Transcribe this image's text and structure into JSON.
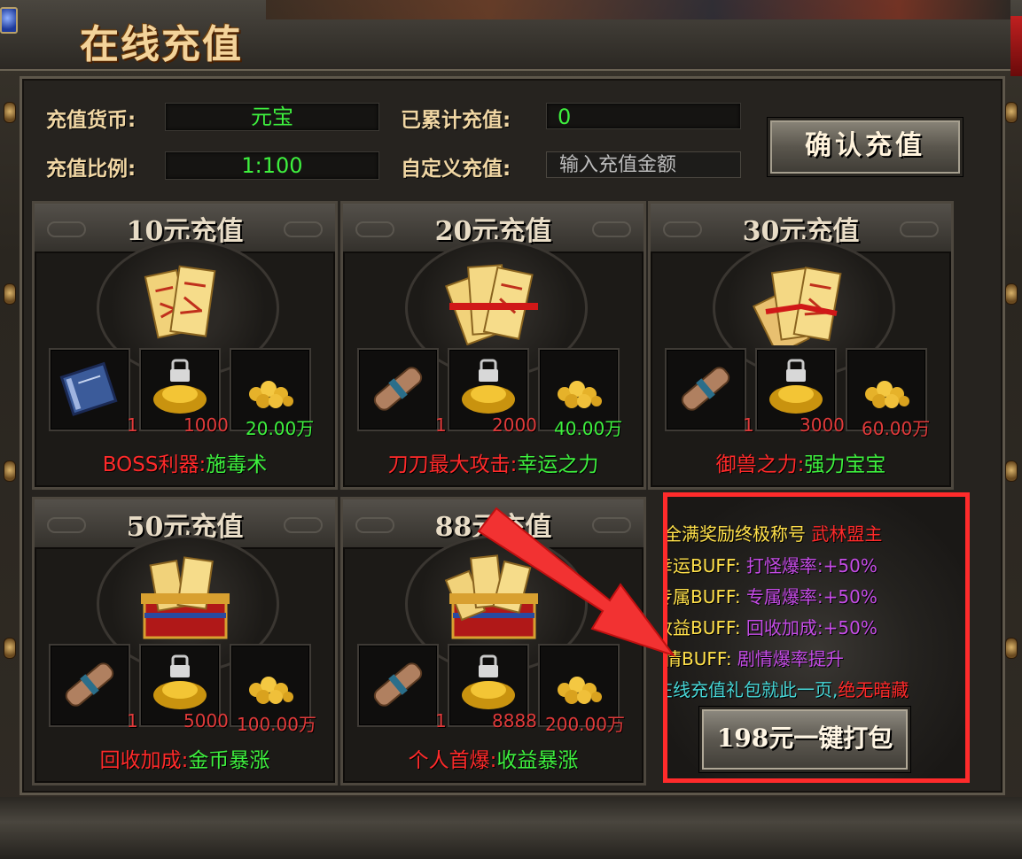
{
  "window": {
    "title": "在线充值"
  },
  "info": {
    "currency_label": "充值货币:",
    "currency_value": "元宝",
    "ratio_label": "充值比例:",
    "ratio_value": "1:100",
    "total_label": "已累计充值:",
    "total_value": "0",
    "custom_label": "自定义充值:",
    "custom_placeholder": "输入充值金额",
    "confirm_label": "确认充值"
  },
  "cards": [
    {
      "title": "10元充值",
      "slots": [
        {
          "icon": "blue-book-icon",
          "qty": "1",
          "qty_color": "#e03a3a"
        },
        {
          "icon": "locked-gold-ingot-icon",
          "qty": "1000",
          "qty_color": "#e03a3a"
        },
        {
          "icon": "gold-coins-icon",
          "qty": "20.00万",
          "qty_color": "#3ef03e"
        }
      ],
      "caption_red": "BOSS利器:",
      "caption_green": "施毒术"
    },
    {
      "title": "20元充值",
      "slots": [
        {
          "icon": "scroll-icon",
          "qty": "1",
          "qty_color": "#e03a3a"
        },
        {
          "icon": "locked-gold-ingot-icon",
          "qty": "2000",
          "qty_color": "#e03a3a"
        },
        {
          "icon": "gold-coins-icon",
          "qty": "40.00万",
          "qty_color": "#3ef03e"
        }
      ],
      "caption_red": "刀刀最大攻击:",
      "caption_green": "幸运之力"
    },
    {
      "title": "30元充值",
      "slots": [
        {
          "icon": "scroll-icon",
          "qty": "1",
          "qty_color": "#e03a3a"
        },
        {
          "icon": "locked-gold-ingot-icon",
          "qty": "3000",
          "qty_color": "#e03a3a"
        },
        {
          "icon": "gold-coins-icon",
          "qty": "60.00万",
          "qty_color": "#e03a3a"
        }
      ],
      "caption_red": "御兽之力:",
      "caption_green": "强力宝宝"
    },
    {
      "title": "50元充值",
      "slots": [
        {
          "icon": "scroll-icon",
          "qty": "1",
          "qty_color": "#e03a3a"
        },
        {
          "icon": "locked-gold-ingot-icon",
          "qty": "5000",
          "qty_color": "#e03a3a"
        },
        {
          "icon": "gold-coins-icon",
          "qty": "100.00万",
          "qty_color": "#e03a3a"
        }
      ],
      "caption_red": "回收加成:",
      "caption_green": "金币暴涨"
    },
    {
      "title": "88元充值",
      "slots": [
        {
          "icon": "scroll-icon",
          "qty": "1",
          "qty_color": "#e03a3a"
        },
        {
          "icon": "locked-gold-ingot-icon",
          "qty": "8888",
          "qty_color": "#e03a3a"
        },
        {
          "icon": "gold-coins-icon",
          "qty": "200.00万",
          "qty_color": "#e03a3a"
        }
      ],
      "caption_red": "个人首爆:",
      "caption_green": "收益暴涨"
    }
  ],
  "bundle": {
    "line1_a": "全满奖励终极称号",
    "line1_b": "武林盟主",
    "line2_a": "幸运BUFF:",
    "line2_b": "打怪爆率:+50%",
    "line3_a": "专属BUFF:",
    "line3_b": "专属爆率:+50%",
    "line4_a": "收益BUFF:",
    "line4_b": "回收加成:+50%",
    "line5_a": "剧情BUFF:",
    "line5_b": "剧情爆率提升",
    "line6_a": "在线充值礼包就此一页,",
    "line6_b": "绝无暗藏",
    "button_label": "198元一键打包"
  },
  "colors": {
    "accent_red": "#ff2b2b",
    "value_green": "#3ef03e",
    "label_gold": "#f1d7a4",
    "buff_purple": "#c54ce6"
  }
}
